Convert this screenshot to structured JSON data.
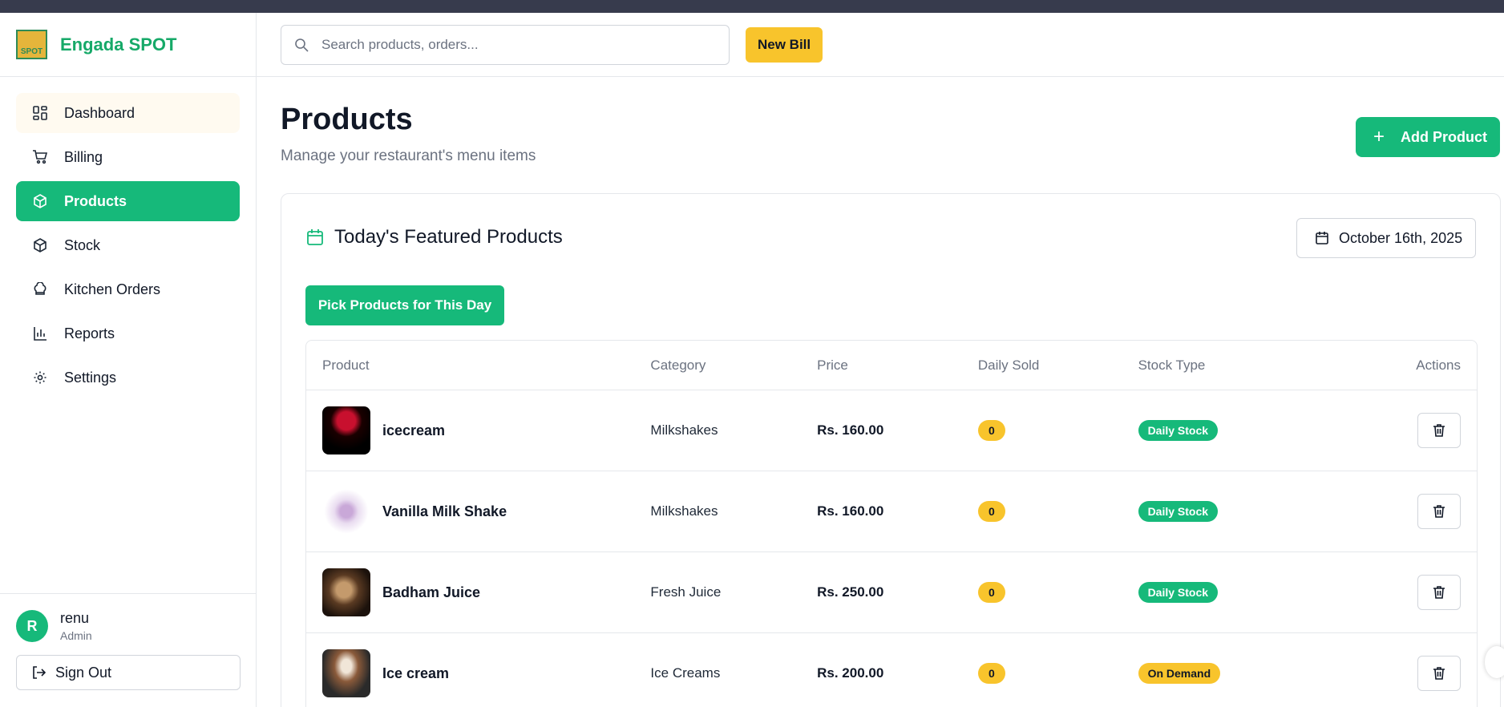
{
  "brand": {
    "name": "Engada SPOT",
    "logo_text": "SPOT"
  },
  "sidebar": {
    "items": [
      {
        "label": "Dashboard",
        "icon": "dashboard-grid-icon",
        "state": "hover"
      },
      {
        "label": "Billing",
        "icon": "cart-icon",
        "state": ""
      },
      {
        "label": "Products",
        "icon": "box-icon",
        "state": "active"
      },
      {
        "label": "Stock",
        "icon": "box-icon",
        "state": ""
      },
      {
        "label": "Kitchen Orders",
        "icon": "chef-hat-icon",
        "state": ""
      },
      {
        "label": "Reports",
        "icon": "bar-chart-icon",
        "state": ""
      },
      {
        "label": "Settings",
        "icon": "gear-icon",
        "state": ""
      }
    ]
  },
  "user": {
    "initial": "R",
    "name": "renu",
    "role": "Admin",
    "signout_label": "Sign Out"
  },
  "header": {
    "search_placeholder": "Search products, orders...",
    "new_bill_label": "New Bill"
  },
  "page": {
    "title": "Products",
    "subtitle": "Manage your restaurant's menu items",
    "add_button_label": "Add Product"
  },
  "featured": {
    "title": "Today's Featured Products",
    "date": "October 16th, 2025",
    "pick_button_label": "Pick Products for This Day",
    "columns": [
      "Product",
      "Category",
      "Price",
      "Daily Sold",
      "Stock Type",
      "Actions"
    ],
    "rows": [
      {
        "name": "icecream",
        "category": "Milkshakes",
        "price": "Rs. 160.00",
        "daily_sold": "0",
        "stock_type": "Daily Stock",
        "stock_kind": "daily"
      },
      {
        "name": "Vanilla Milk Shake",
        "category": "Milkshakes",
        "price": "Rs. 160.00",
        "daily_sold": "0",
        "stock_type": "Daily Stock",
        "stock_kind": "daily"
      },
      {
        "name": "Badham Juice",
        "category": "Fresh Juice",
        "price": "Rs. 250.00",
        "daily_sold": "0",
        "stock_type": "Daily Stock",
        "stock_kind": "daily"
      },
      {
        "name": "Ice cream",
        "category": "Ice Creams",
        "price": "Rs. 200.00",
        "daily_sold": "0",
        "stock_type": "On Demand",
        "stock_kind": "demand"
      }
    ]
  },
  "colors": {
    "primary": "#16b97a",
    "accent": "#f8c42c",
    "sidebar_hover": "#fffaf0"
  }
}
